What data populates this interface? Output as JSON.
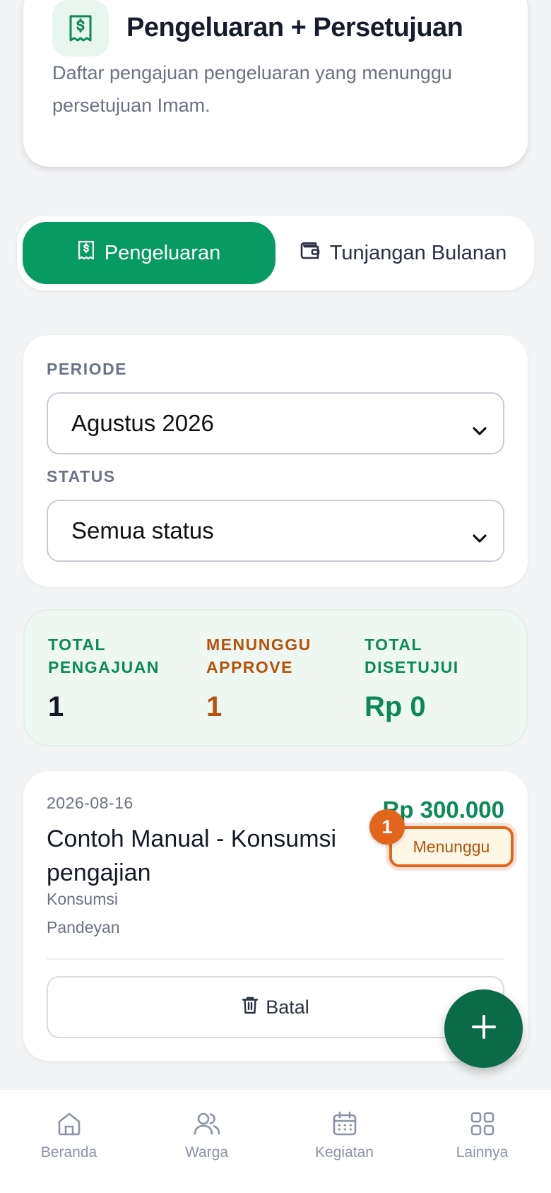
{
  "header": {
    "title": "Pengeluaran + Persetujuan",
    "description": "Daftar pengajuan pengeluaran yang menunggu persetujuan Imam.",
    "icon": "receipt-icon"
  },
  "tabs": [
    {
      "label": "Pengeluaran",
      "icon": "receipt-icon",
      "active": true
    },
    {
      "label": "Tunjangan Bulanan",
      "icon": "wallet-icon",
      "active": false
    }
  ],
  "filters": {
    "period_label": "PERIODE",
    "period_value": "Agustus 2026",
    "status_label": "STATUS",
    "status_value": "Semua status"
  },
  "summary": [
    {
      "label": "TOTAL PENGAJUAN",
      "value": "1",
      "label_color": "#0b8a57",
      "value_color": "#111827"
    },
    {
      "label": "MENUNGGU APPROVE",
      "value": "1",
      "label_color": "#b45309",
      "value_color": "#b45309"
    },
    {
      "label": "TOTAL DISETUJUI",
      "value": "Rp 0",
      "label_color": "#0b8a57",
      "value_color": "#0b8a57"
    }
  ],
  "expenses": [
    {
      "date": "2026-08-16",
      "title": "Contoh Manual - Konsumsi pengajian",
      "category": "Konsumsi",
      "location": "Pandeyan",
      "amount": "Rp 300.000",
      "status": "Menunggu",
      "marker": "1",
      "cancel_label": "Batal"
    }
  ],
  "fab": {
    "icon": "plus-icon"
  },
  "bottom_nav": [
    {
      "label": "Beranda",
      "icon": "home-icon"
    },
    {
      "label": "Warga",
      "icon": "users-icon"
    },
    {
      "label": "Kegiatan",
      "icon": "calendar-icon"
    },
    {
      "label": "Lainnya",
      "icon": "grid-icon"
    }
  ],
  "colors": {
    "primary": "#079a63",
    "accent_orange": "#e3651b",
    "background": "#f3f4f5"
  }
}
